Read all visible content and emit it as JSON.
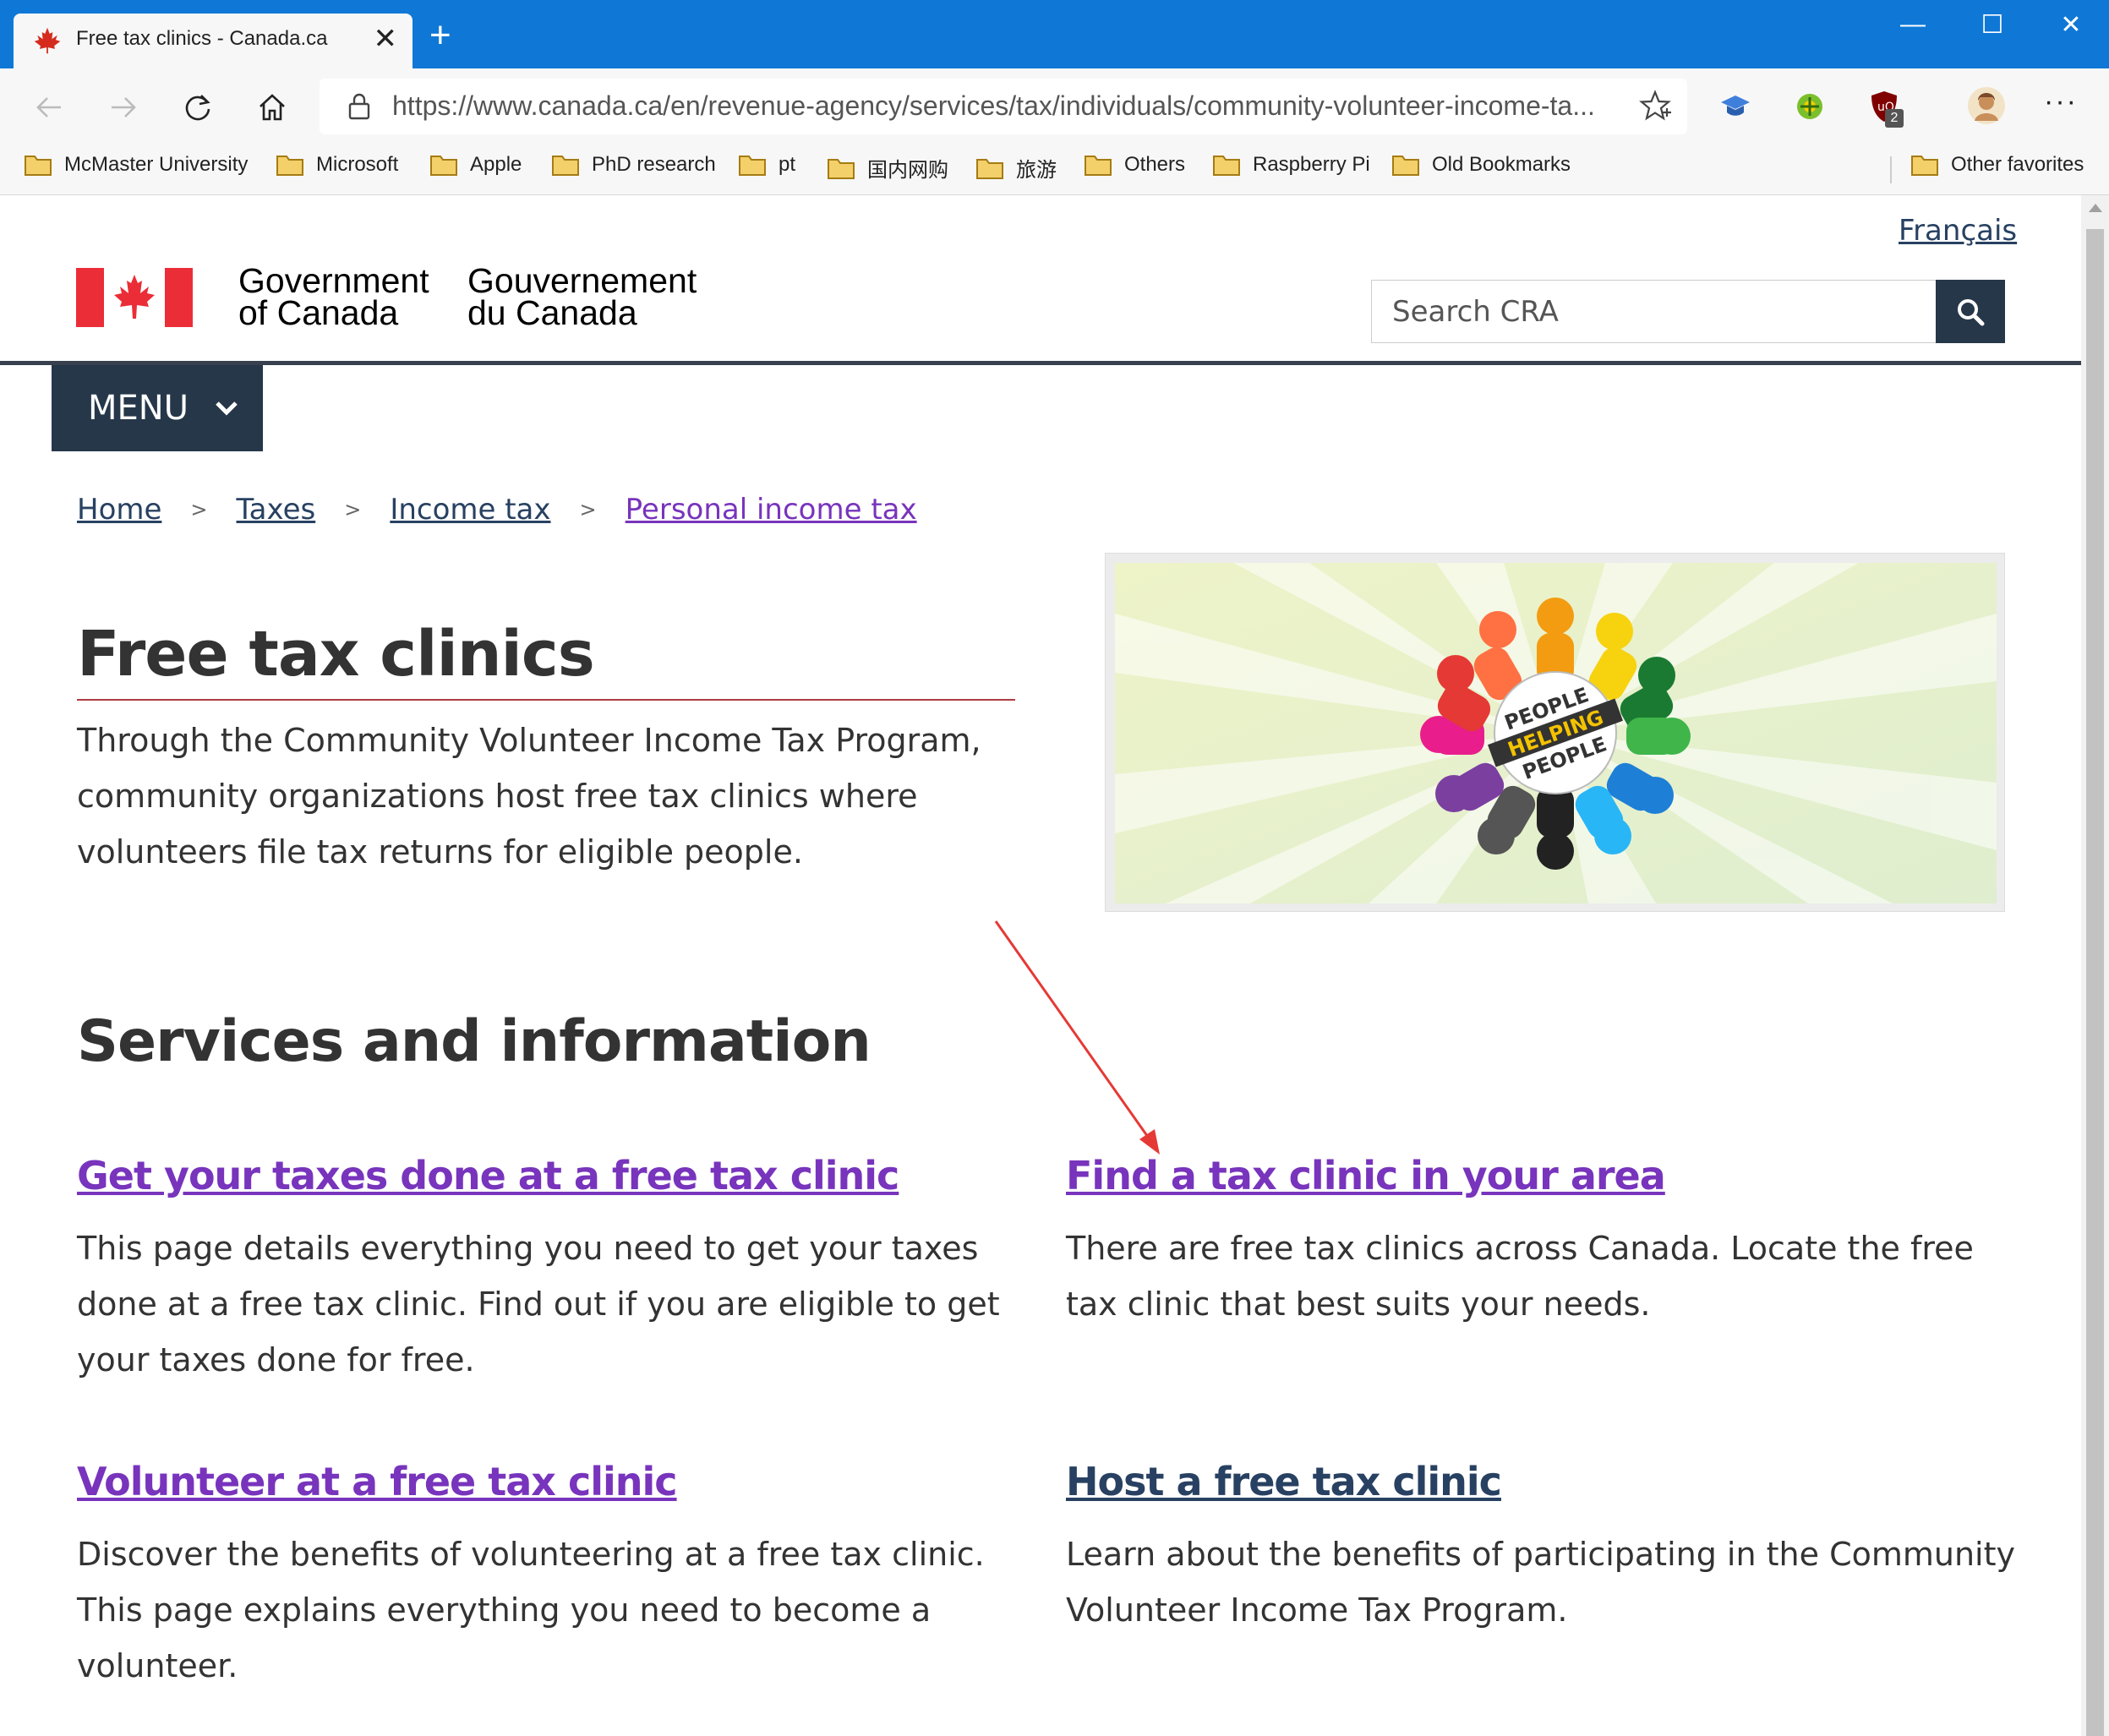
{
  "browser": {
    "tab_title": "Free tax clinics - Canada.ca",
    "tab_close": "✕",
    "new_tab": "+",
    "window_controls": {
      "minimize": "—",
      "maximize": "☐",
      "close": "✕"
    },
    "url": "https://www.canada.ca/en/revenue-agency/services/tax/individuals/community-volunteer-income-ta...",
    "menu_dots": "···",
    "extension_badge": "2",
    "bookmarks": [
      "McMaster University",
      "Microsoft",
      "Apple",
      "PhD research",
      "pt",
      "国内网购",
      "旅游",
      "Others",
      "Raspberry Pi",
      "Old Bookmarks"
    ],
    "other_favorites": "Other favorites"
  },
  "header": {
    "language_toggle": "Français",
    "signature_en_line1": "Government",
    "signature_en_line2": "of Canada",
    "signature_fr_line1": "Gouvernement",
    "signature_fr_line2": "du Canada",
    "search_placeholder": "Search CRA",
    "menu_label": "MENU"
  },
  "breadcrumb": [
    "Home",
    "Taxes",
    "Income tax",
    "Personal income tax"
  ],
  "main": {
    "title": "Free tax clinics",
    "intro": "Through the Community Volunteer Income Tax Program, community organizations host free tax clinics where volunteers file tax returns for eligible people.",
    "hero_image_text": [
      "PEOPLE",
      "HELPING",
      "PEOPLE"
    ],
    "section_heading": "Services and information",
    "cards": [
      {
        "title": "Get your taxes done at a free tax clinic",
        "description": "This page details everything you need to get your taxes done at a free tax clinic. Find out if you are eligible to get your taxes done for free."
      },
      {
        "title": "Find a tax clinic in your area",
        "description": "There are free tax clinics across Canada. Locate the free tax clinic that best suits your needs."
      },
      {
        "title": "Volunteer at a free tax clinic",
        "description": "Discover the benefits of volunteering at a free tax clinic. This page explains everything you need to become a volunteer."
      },
      {
        "title": "Host a free tax clinic",
        "description": "Learn about the benefits of participating in the Community Volunteer Income Tax Program."
      }
    ]
  },
  "colors": {
    "titlebar": "#0f78d7",
    "link": "#284162",
    "visited_link": "#7834bc",
    "menu_bg": "#26374a",
    "h1_rule": "#af3c43",
    "flag_red": "#eb2d37",
    "annotation_arrow": "#e53935"
  }
}
